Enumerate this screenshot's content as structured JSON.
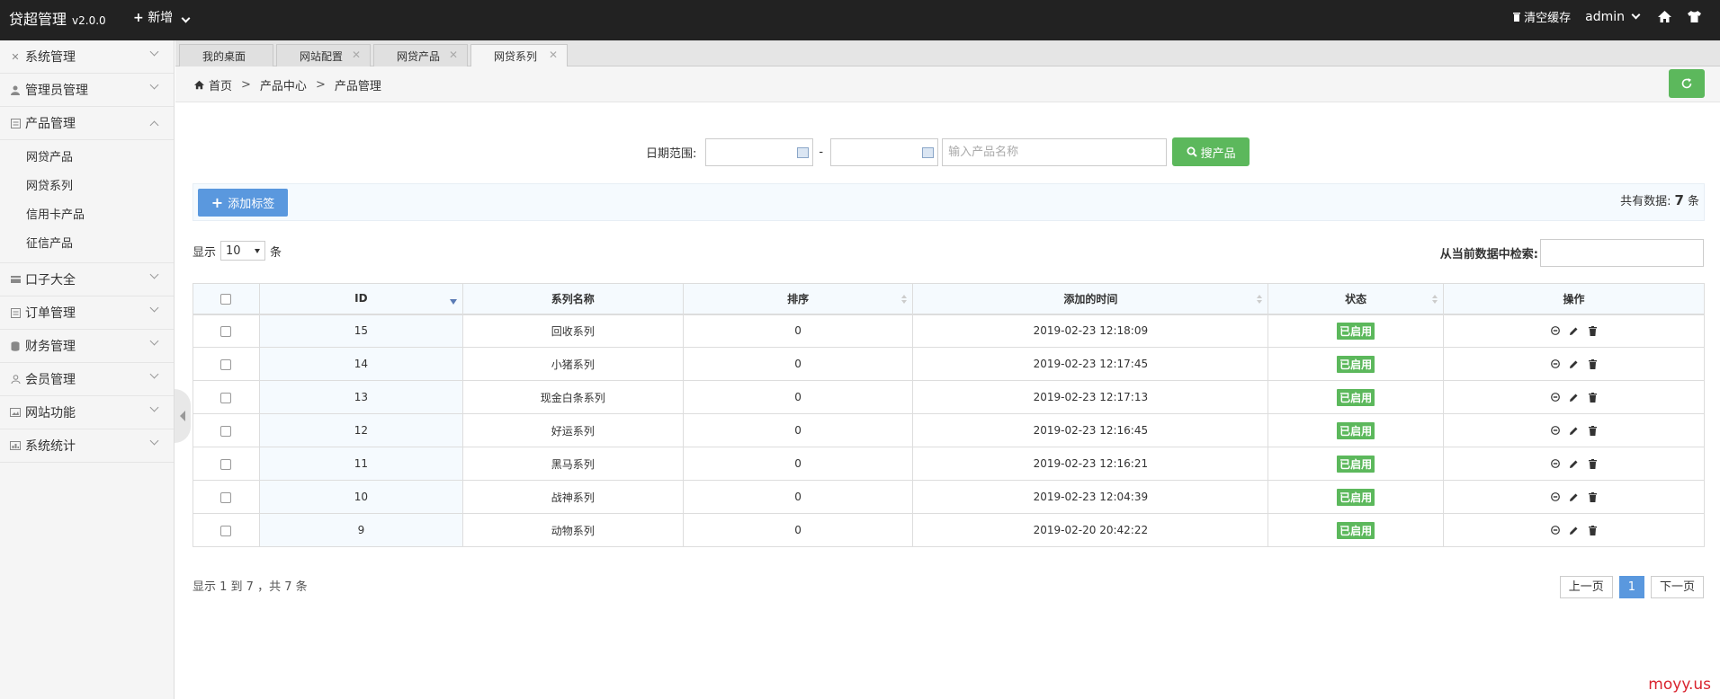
{
  "header": {
    "brand": "贷超管理",
    "version": "v2.0.0",
    "add_menu": "新增",
    "clear_cache": "清空缓存",
    "user": "admin"
  },
  "sidebar": {
    "items": [
      {
        "label": "系统管理",
        "icon": "wrench-icon",
        "expanded": false
      },
      {
        "label": "管理员管理",
        "icon": "user-icon",
        "expanded": false
      },
      {
        "label": "产品管理",
        "icon": "list-icon",
        "expanded": true,
        "children": [
          "网贷产品",
          "网贷系列",
          "信用卡产品",
          "征信产品"
        ]
      },
      {
        "label": "口子大全",
        "icon": "card-icon",
        "expanded": false
      },
      {
        "label": "订单管理",
        "icon": "list-icon",
        "expanded": false
      },
      {
        "label": "财务管理",
        "icon": "database-icon",
        "expanded": false
      },
      {
        "label": "会员管理",
        "icon": "users-icon",
        "expanded": false
      },
      {
        "label": "网站功能",
        "icon": "picture-icon",
        "expanded": false
      },
      {
        "label": "系统统计",
        "icon": "chart-icon",
        "expanded": false
      }
    ]
  },
  "tabs": [
    {
      "label": "我的桌面",
      "closable": false
    },
    {
      "label": "网站配置",
      "closable": true
    },
    {
      "label": "网贷产品",
      "closable": true
    },
    {
      "label": "网贷系列",
      "closable": true,
      "active": true
    }
  ],
  "breadcrumb": {
    "home": "首页",
    "level1": "产品中心",
    "level2": "产品管理",
    "sep": ">"
  },
  "search": {
    "date_label": "日期范围:",
    "dash": "-",
    "name_placeholder": "输入产品名称",
    "button": "搜产品"
  },
  "actions": {
    "add_button": "添加标签",
    "total_prefix": "共有数据:",
    "total_count": "7",
    "total_suffix": "条"
  },
  "length": {
    "prefix": "显示",
    "value": "10",
    "suffix": "条"
  },
  "filter": {
    "label": "从当前数据中检索:"
  },
  "table": {
    "columns": [
      "ID",
      "系列名称",
      "排序",
      "添加的时间",
      "状态",
      "操作"
    ],
    "rows": [
      {
        "id": "15",
        "name": "回收系列",
        "sort": "0",
        "time": "2019-02-23 12:18:09",
        "status": "已启用"
      },
      {
        "id": "14",
        "name": "小猪系列",
        "sort": "0",
        "time": "2019-02-23 12:17:45",
        "status": "已启用"
      },
      {
        "id": "13",
        "name": "现金白条系列",
        "sort": "0",
        "time": "2019-02-23 12:17:13",
        "status": "已启用"
      },
      {
        "id": "12",
        "name": "好运系列",
        "sort": "0",
        "time": "2019-02-23 12:16:45",
        "status": "已启用"
      },
      {
        "id": "11",
        "name": "黑马系列",
        "sort": "0",
        "time": "2019-02-23 12:16:21",
        "status": "已启用"
      },
      {
        "id": "10",
        "name": "战神系列",
        "sort": "0",
        "time": "2019-02-23 12:04:39",
        "status": "已启用"
      },
      {
        "id": "9",
        "name": "动物系列",
        "sort": "0",
        "time": "2019-02-20 20:42:22",
        "status": "已启用"
      }
    ]
  },
  "footer": {
    "info": "显示 1 到 7 ，共 7 条",
    "prev": "上一页",
    "current": "1",
    "next": "下一页"
  },
  "watermark": "moyy.us",
  "colors": {
    "topbar": "#222222",
    "primary": "#5a98de",
    "success": "#5cb85c",
    "watermark": "#d9232e"
  }
}
